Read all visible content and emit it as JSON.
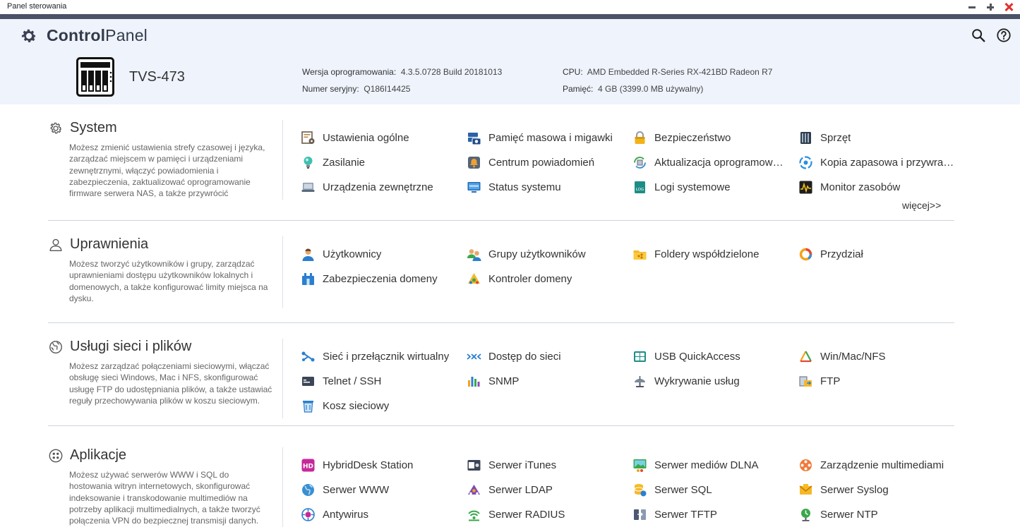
{
  "window": {
    "title": "Panel sterowania"
  },
  "header": {
    "brand_bold": "Control",
    "brand_light": "Panel",
    "device_name": "TVS-473",
    "info": [
      {
        "label": "Wersja oprogramowania:",
        "value": "4.3.5.0728 Build 20181013"
      },
      {
        "label": "Numer seryjny:",
        "value": "Q186I14425"
      },
      {
        "label": "CPU:",
        "value": "AMD Embedded R-Series RX-421BD Radeon R7"
      },
      {
        "label": "Pamięć:",
        "value": "4 GB (3399.0 MB używalny)"
      }
    ]
  },
  "sections": [
    {
      "title": "System",
      "description": "Możesz zmienić ustawienia strefy czasowej i języka, zarządzać miejscem w pamięci i urządzeniami zewnętrznymi, włączyć powiadomienia i zabezpieczenia, zaktualizować oprogramowanie firmware serwera NAS, a także przywrócić",
      "items": [
        {
          "label": "Ustawienia ogólne",
          "icon": "general-settings-icon"
        },
        {
          "label": "Pamięć masowa i migawki",
          "icon": "storage-snapshots-icon"
        },
        {
          "label": "Bezpieczeństwo",
          "icon": "lock-icon"
        },
        {
          "label": "Sprzęt",
          "icon": "hardware-icon"
        },
        {
          "label": "Zasilanie",
          "icon": "power-bulb-icon"
        },
        {
          "label": "Centrum powiadomień",
          "icon": "notification-center-icon"
        },
        {
          "label": "Aktualizacja oprogramow…",
          "icon": "firmware-update-icon"
        },
        {
          "label": "Kopia zapasowa i przywra…",
          "icon": "backup-restore-icon"
        },
        {
          "label": "Urządzenia zewnętrzne",
          "icon": "external-device-icon"
        },
        {
          "label": "Status systemu",
          "icon": "system-status-icon"
        },
        {
          "label": "Logi systemowe",
          "icon": "system-logs-icon"
        },
        {
          "label": "Monitor zasobów",
          "icon": "resource-monitor-icon"
        }
      ],
      "more": "więcej>>"
    },
    {
      "title": "Uprawnienia",
      "description": "Możesz tworzyć użytkowników i grupy, zarządzać uprawnieniami dostępu użytkowników lokalnych i domenowych, a także konfigurować limity miejsca na dysku.",
      "items": [
        {
          "label": "Użytkownicy",
          "icon": "users-icon"
        },
        {
          "label": "Grupy użytkowników",
          "icon": "user-groups-icon"
        },
        {
          "label": "Foldery współdzielone",
          "icon": "shared-folders-icon"
        },
        {
          "label": "Przydział",
          "icon": "quota-icon"
        },
        {
          "label": "Zabezpieczenia domeny",
          "icon": "domain-security-icon"
        },
        {
          "label": "Kontroler domeny",
          "icon": "domain-controller-icon"
        }
      ]
    },
    {
      "title": "Usługi sieci i plików",
      "description": "Możesz zarządzać połączeniami sieciowymi, włączać obsługę sieci Windows, Mac i NFS, skonfigurować usługę FTP do udostępniania plików, a także ustawiać reguły przechowywania plików w koszu sieciowym.",
      "items": [
        {
          "label": "Sieć i przełącznik wirtualny",
          "icon": "network-switch-icon"
        },
        {
          "label": "Dostęp do sieci",
          "icon": "network-access-icon"
        },
        {
          "label": "USB QuickAccess",
          "icon": "usb-quickaccess-icon"
        },
        {
          "label": "Win/Mac/NFS",
          "icon": "win-mac-nfs-icon"
        },
        {
          "label": "Telnet / SSH",
          "icon": "telnet-ssh-icon"
        },
        {
          "label": "SNMP",
          "icon": "snmp-icon"
        },
        {
          "label": "Wykrywanie usług",
          "icon": "service-discovery-icon"
        },
        {
          "label": "FTP",
          "icon": "ftp-icon"
        },
        {
          "label": "Kosz sieciowy",
          "icon": "network-recycle-bin-icon"
        }
      ]
    },
    {
      "title": "Aplikacje",
      "description": "Możesz używać serwerów WWW i SQL do hostowania witryn internetowych, skonfigurować indeksowanie i transkodowanie multimediów na potrzeby aplikacji multimedialnych, a także tworzyć połączenia VPN do bezpiecznej transmisji danych.",
      "items": [
        {
          "label": "HybridDesk Station",
          "icon": "hybriddesk-icon"
        },
        {
          "label": "Serwer iTunes",
          "icon": "itunes-server-icon"
        },
        {
          "label": "Serwer mediów DLNA",
          "icon": "dlna-server-icon"
        },
        {
          "label": "Zarządzenie multimediami",
          "icon": "multimedia-management-icon"
        },
        {
          "label": "Serwer WWW",
          "icon": "web-server-icon"
        },
        {
          "label": "Serwer LDAP",
          "icon": "ldap-server-icon"
        },
        {
          "label": "Serwer SQL",
          "icon": "sql-server-icon"
        },
        {
          "label": "Serwer Syslog",
          "icon": "syslog-server-icon"
        },
        {
          "label": "Antywirus",
          "icon": "antivirus-icon"
        },
        {
          "label": "Serwer RADIUS",
          "icon": "radius-server-icon"
        },
        {
          "label": "Serwer TFTP",
          "icon": "tftp-server-icon"
        },
        {
          "label": "Serwer NTP",
          "icon": "ntp-server-icon"
        }
      ]
    }
  ]
}
